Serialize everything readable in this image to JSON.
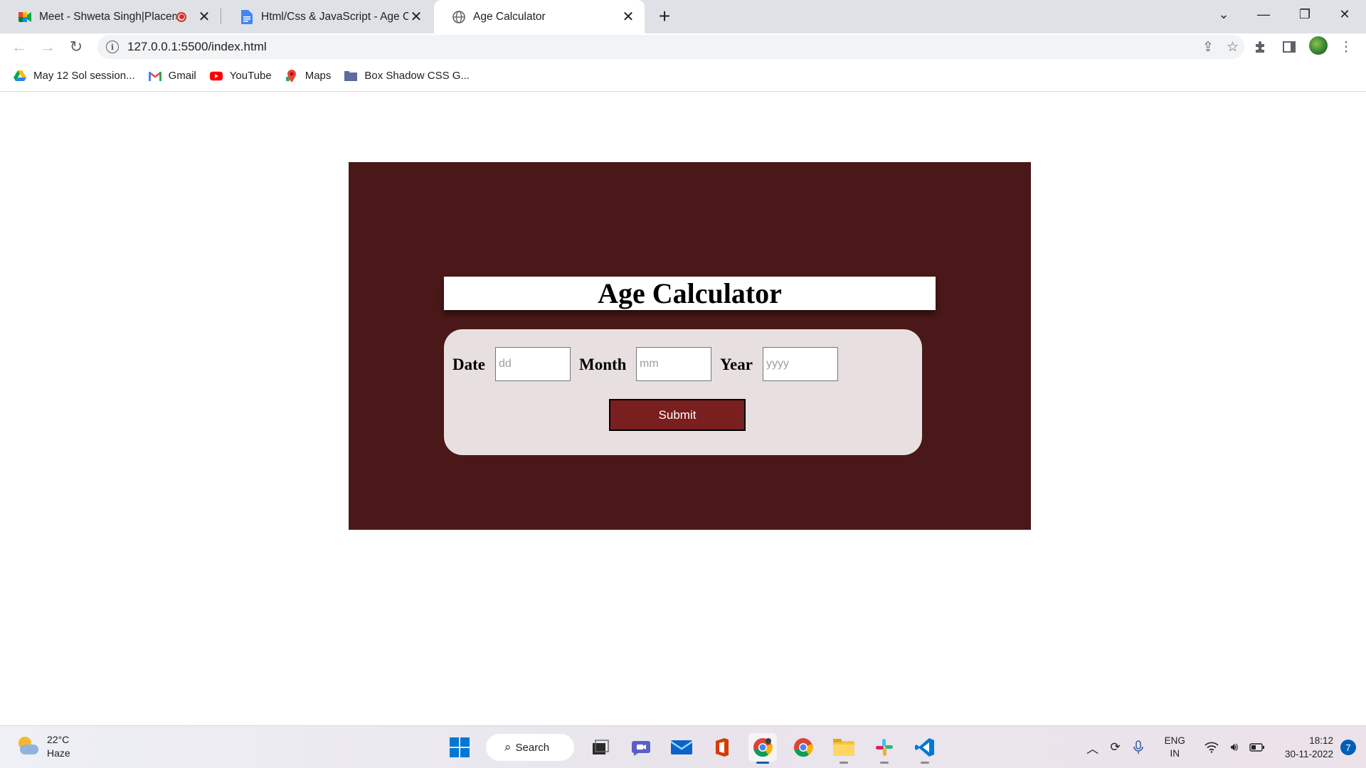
{
  "browser": {
    "tabs": [
      {
        "title": "Meet - Shweta Singh|Placem",
        "icon": "google-meet-icon",
        "recording": true
      },
      {
        "title": "Html/Css & JavaScript - Age Calc",
        "icon": "google-docs-icon"
      },
      {
        "title": "Age Calculator",
        "icon": "globe-icon",
        "active": true
      }
    ],
    "address_bar": {
      "url": "127.0.0.1:5500/index.html"
    },
    "bookmarks": [
      {
        "label": "May 12 Sol session...",
        "icon": "google-drive-icon"
      },
      {
        "label": "Gmail",
        "icon": "gmail-icon"
      },
      {
        "label": "YouTube",
        "icon": "youtube-icon"
      },
      {
        "label": "Maps",
        "icon": "google-maps-icon"
      },
      {
        "label": "Box Shadow CSS G...",
        "icon": "folder-icon"
      }
    ]
  },
  "page": {
    "title": "Age Calculator",
    "fields": {
      "date": {
        "label": "Date",
        "placeholder": "dd",
        "value": ""
      },
      "month": {
        "label": "Month",
        "placeholder": "mm",
        "value": ""
      },
      "year": {
        "label": "Year",
        "placeholder": "yyyy",
        "value": ""
      }
    },
    "submit_label": "Submit",
    "colors": {
      "panel_bg": "#4a1818",
      "card_bg": "#e8e0e0",
      "button_bg": "#7a1f1f"
    }
  },
  "taskbar": {
    "weather": {
      "temp": "22°C",
      "condition": "Haze"
    },
    "search_label": "Search",
    "language": {
      "line1": "ENG",
      "line2": "IN"
    },
    "clock": {
      "time": "18:12",
      "date": "30-11-2022"
    },
    "notification_count": "7"
  }
}
